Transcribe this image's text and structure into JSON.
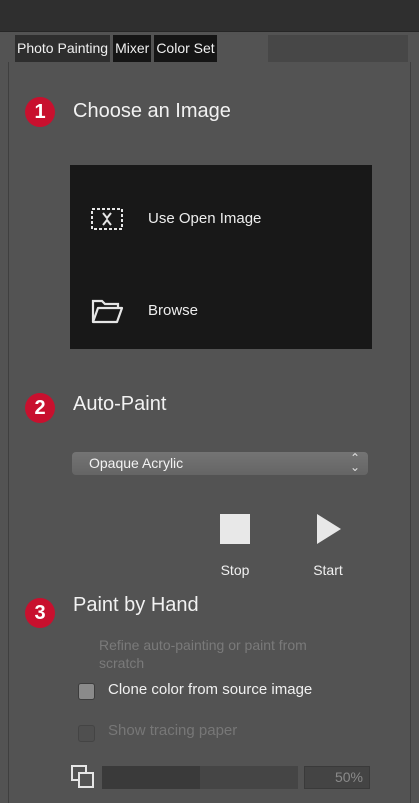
{
  "tabs": [
    {
      "label": "Photo Painting",
      "active": true
    },
    {
      "label": "Mixer",
      "active": false
    },
    {
      "label": "Color Set",
      "active": false
    }
  ],
  "step1": {
    "number": "1",
    "title": "Choose an Image"
  },
  "image_source": {
    "use_open_label": "Use Open Image",
    "browse_label": "Browse"
  },
  "step2": {
    "number": "2",
    "title": "Auto-Paint"
  },
  "auto_paint": {
    "style_value": "Opaque Acrylic",
    "stop_label": "Stop",
    "start_label": "Start"
  },
  "step3": {
    "number": "3",
    "title": "Paint by Hand"
  },
  "paint_by_hand": {
    "hint_line1": "Refine auto-painting or paint from",
    "hint_line2": "scratch",
    "clone_color_label": "Clone color from source image",
    "clone_color_checked": true,
    "tracing_paper_label": "Show tracing paper",
    "tracing_paper_checked": false,
    "tracing_opacity": "50%",
    "tracing_opacity_fraction": 0.5
  },
  "colors": {
    "badge": "#c8102e",
    "panel_bg": "#535353",
    "box_bg": "#181818"
  }
}
